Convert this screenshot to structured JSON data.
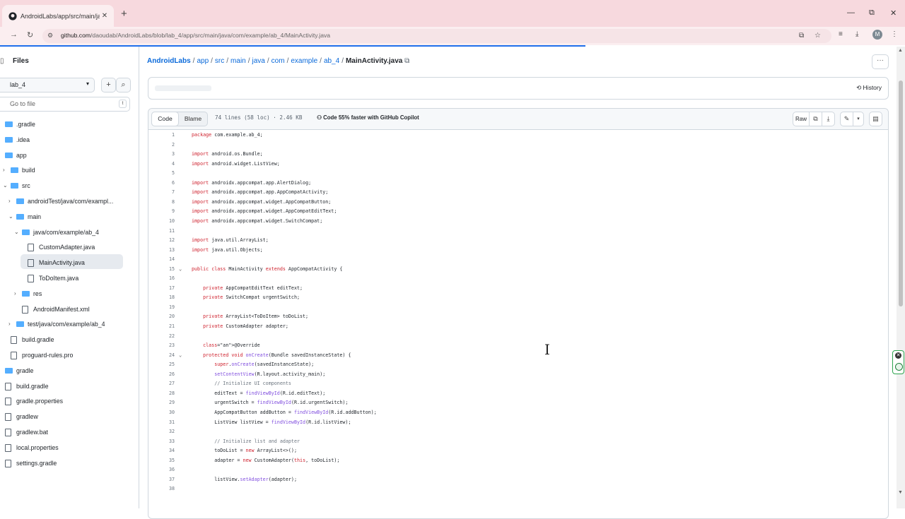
{
  "browser": {
    "tab_title": "AndroidLabs/app/src/main/ja...",
    "new_tab_label": "+",
    "url_host": "github.com",
    "url_path": "/daoudab/AndroidLabs/blob/lab_4/app/src/main/java/com/example/ab_4/MainActivity.java",
    "avatar_letter": "M"
  },
  "sidebar": {
    "title": "Files",
    "branch": "lab_4",
    "goto_placeholder": "Go to file",
    "goto_shortcut": "t",
    "tree": [
      {
        "label": ".gradle",
        "type": "folder"
      },
      {
        "label": ".idea",
        "type": "folder"
      },
      {
        "label": "app",
        "type": "folder"
      },
      {
        "label": "build",
        "type": "folder"
      },
      {
        "label": "src",
        "type": "folder"
      },
      {
        "label": "androidTest/java/com/exampl...",
        "type": "folder"
      },
      {
        "label": "main",
        "type": "folder"
      },
      {
        "label": "java/com/example/ab_4",
        "type": "folder"
      },
      {
        "label": "CustomAdapter.java",
        "type": "file"
      },
      {
        "label": "MainActivity.java",
        "type": "file"
      },
      {
        "label": "ToDoItem.java",
        "type": "file"
      },
      {
        "label": "res",
        "type": "folder"
      },
      {
        "label": "AndroidManifest.xml",
        "type": "file"
      },
      {
        "label": "test/java/com/example/ab_4",
        "type": "folder"
      },
      {
        "label": "build.gradle",
        "type": "file"
      },
      {
        "label": "proguard-rules.pro",
        "type": "file"
      },
      {
        "label": "gradle",
        "type": "folder"
      },
      {
        "label": "build.gradle",
        "type": "file"
      },
      {
        "label": "gradle.properties",
        "type": "file"
      },
      {
        "label": "gradlew",
        "type": "file"
      },
      {
        "label": "gradlew.bat",
        "type": "file"
      },
      {
        "label": "local.properties",
        "type": "file"
      },
      {
        "label": "settings.gradle",
        "type": "file"
      }
    ]
  },
  "breadcrumb": [
    "AndroidLabs",
    "app",
    "src",
    "main",
    "java",
    "com",
    "example",
    "ab_4"
  ],
  "breadcrumb_current": "MainActivity.java",
  "history_label": "History",
  "file_header": {
    "tab_code": "Code",
    "tab_blame": "Blame",
    "meta": "74 lines (58 loc) · 2.46 KB",
    "copilot": "Code 55% faster with GitHub Copilot",
    "raw": "Raw"
  },
  "code_lines": [
    "package com.example.ab_4;",
    "",
    "import android.os.Bundle;",
    "import android.widget.ListView;",
    "",
    "import androidx.appcompat.app.AlertDialog;",
    "import androidx.appcompat.app.AppCompatActivity;",
    "import androidx.appcompat.widget.AppCompatButton;",
    "import androidx.appcompat.widget.AppCompatEditText;",
    "import androidx.appcompat.widget.SwitchCompat;",
    "",
    "import java.util.ArrayList;",
    "import java.util.Objects;",
    "",
    "public class MainActivity extends AppCompatActivity {",
    "",
    "    private AppCompatEditText editText;",
    "    private SwitchCompat urgentSwitch;",
    "",
    "    private ArrayList<ToDoItem> toDoList;",
    "    private CustomAdapter adapter;",
    "",
    "    @Override",
    "    protected void onCreate(Bundle savedInstanceState) {",
    "        super.onCreate(savedInstanceState);",
    "        setContentView(R.layout.activity_main);",
    "        // Initialize UI components",
    "        editText = findViewById(R.id.editText);",
    "        urgentSwitch = findViewById(R.id.urgentSwitch);",
    "        AppCompatButton addButton = findViewById(R.id.addButton);",
    "        ListView listView = findViewById(R.id.listView);",
    "",
    "        // Initialize list and adapter",
    "        toDoList = new ArrayList<>();",
    "        adapter = new CustomAdapter(this, toDoList);",
    "",
    "        listView.setAdapter(adapter);",
    ""
  ],
  "fold_lines": [
    15,
    24
  ]
}
